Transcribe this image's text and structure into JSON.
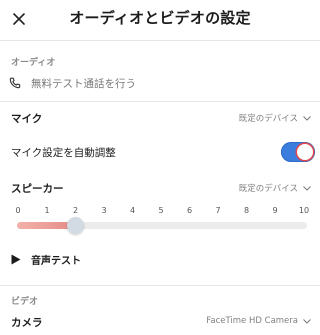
{
  "header": {
    "title": "オーディオとビデオの設定",
    "close_icon": "close-icon"
  },
  "audio": {
    "section_label": "オーディオ",
    "test_call": {
      "icon": "phone-icon",
      "label": "無料テスト通話を行う"
    },
    "microphone": {
      "label": "マイク",
      "value": "既定のデバイス"
    },
    "auto_adjust": {
      "label": "マイク設定を自動調整",
      "enabled": true
    },
    "speaker": {
      "label": "スピーカー",
      "value": "既定のデバイス"
    },
    "volume": {
      "ticks": [
        "0",
        "1",
        "2",
        "3",
        "4",
        "5",
        "6",
        "7",
        "8",
        "9",
        "10"
      ],
      "value": 2,
      "max": 10
    },
    "sound_test": {
      "icon": "play-icon",
      "label": "音声テスト"
    }
  },
  "video": {
    "section_label": "ビデオ",
    "camera": {
      "label": "カメラ",
      "value": "FaceTime HD Camera"
    }
  },
  "colors": {
    "toggle_on": "#3b7ddd",
    "slider_fill": "#e58c86",
    "slider_thumb": "#d2dae3"
  }
}
